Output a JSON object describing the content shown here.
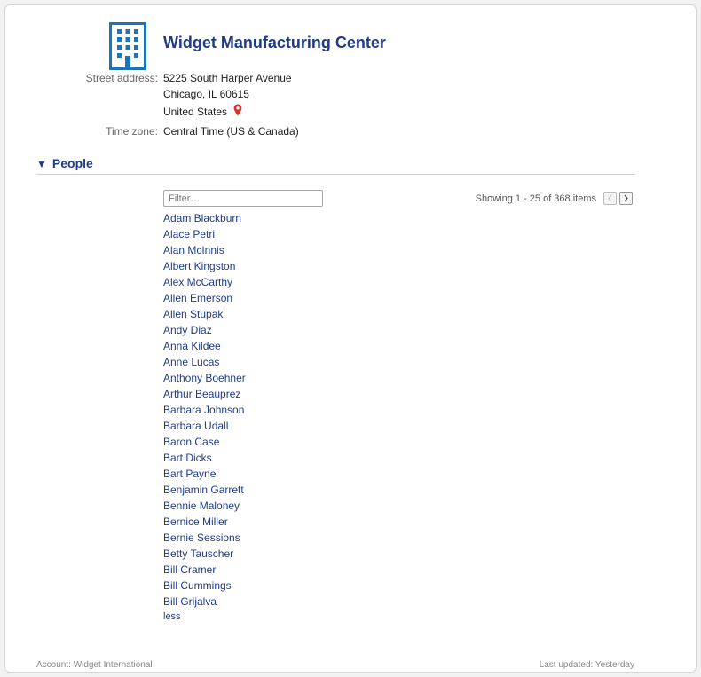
{
  "header": {
    "title": "Widget Manufacturing Center"
  },
  "details": {
    "street_label": "Street address:",
    "street_line1": "5225 South Harper Avenue",
    "street_line2": "Chicago, IL 60615",
    "street_line3": "United States",
    "timezone_label": "Time zone:",
    "timezone_value": "Central Time (US & Canada)"
  },
  "people": {
    "section_title": "People",
    "filter_placeholder": "Filter…",
    "showing_text": "Showing 1 - 25 of 368 items",
    "names": [
      "Adam Blackburn",
      "Alace Petri",
      "Alan McInnis",
      "Albert Kingston",
      "Alex McCarthy",
      "Allen Emerson",
      "Allen Stupak",
      "Andy Diaz",
      "Anna Kildee",
      "Anne Lucas",
      "Anthony Boehner",
      "Arthur Beauprez",
      "Barbara Johnson",
      "Barbara Udall",
      "Baron Case",
      "Bart Dicks",
      "Bart Payne",
      "Benjamin Garrett",
      "Bennie Maloney",
      "Bernice Miller",
      "Bernie Sessions",
      "Betty Tauscher",
      "Bill Cramer",
      "Bill Cummings",
      "Bill Grijalva"
    ],
    "less_label": "less"
  },
  "footer": {
    "account": "Account: Widget International",
    "updated": "Last updated: Yesterday"
  },
  "icons": {
    "building": "building-icon",
    "pin": "map-pin-icon",
    "caret": "caret-down-icon",
    "prev": "chevron-left-icon",
    "next": "chevron-right-icon"
  },
  "colors": {
    "accent": "#1f3c88",
    "icon_blue": "#1976b8",
    "pin_red": "#d9342b"
  }
}
